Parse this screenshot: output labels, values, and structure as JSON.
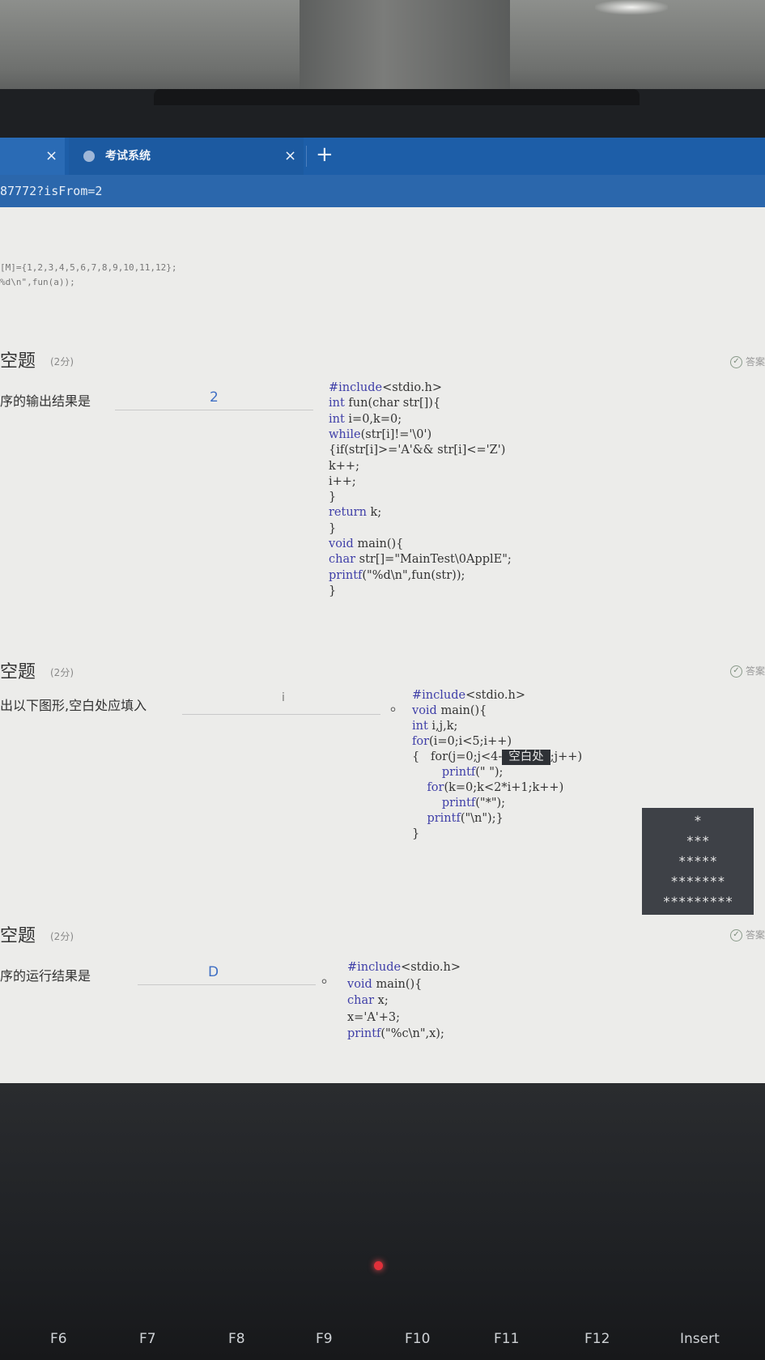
{
  "browser": {
    "tabs": [
      {
        "label": "",
        "close": "×"
      },
      {
        "label": "考试系统",
        "close": "×"
      }
    ],
    "new_tab": "+",
    "address": "87772?isFrom=2"
  },
  "top_fragment": {
    "line1": "[M]={1,2,3,4,5,6,7,8,9,10,11,12};",
    "line2": "%d\\n\",fun(a));"
  },
  "questions": [
    {
      "title": "空题",
      "score": "(2分)",
      "text": "序的输出结果是",
      "answer": "2",
      "answer_tag": "答案",
      "code": [
        "#include<stdio.h>",
        "int fun(char str[]){",
        "int i=0,k=0;",
        "while(str[i]!='\\0')",
        "{if(str[i]>='A'&& str[i]<='Z')",
        "k++;",
        "i++;",
        "}",
        "return k;",
        "}",
        "void main(){",
        "char str[]=\"MainTest\\0ApplE\";",
        "printf(\"%d\\n\",fun(str));",
        "}"
      ]
    },
    {
      "title": "空题",
      "score": "(2分)",
      "text": "出以下图形,空白处应填入",
      "answer": "i",
      "period": "。",
      "answer_tag": "答案",
      "code": [
        "#include<stdio.h>",
        "void main(){",
        "int i,j,k;",
        "for(i=0;i<5;i++)",
        "{   for(j=0;j<4-",
        "        printf(\" \");",
        "    for(k=0;k<2*i+1;k++)",
        "        printf(\"*\");",
        "    printf(\"\\n\");}",
        "}"
      ],
      "blank_label": "空白处",
      "after_blank": ";j++)",
      "stars": [
        "*",
        "***",
        "*****",
        "*******",
        "*********"
      ]
    },
    {
      "title": "空题",
      "score": "(2分)",
      "text": "序的运行结果是",
      "answer": "D",
      "period": "。",
      "answer_tag": "答案",
      "code": [
        "#include<stdio.h>",
        "void main(){",
        "char x;",
        "x='A'+3;",
        "printf(\"%c\\n\",x);"
      ]
    }
  ],
  "keyboard": {
    "keys": [
      "F6",
      "F7",
      "F8",
      "F9",
      "F10",
      "F11",
      "F12",
      "Insert"
    ]
  }
}
